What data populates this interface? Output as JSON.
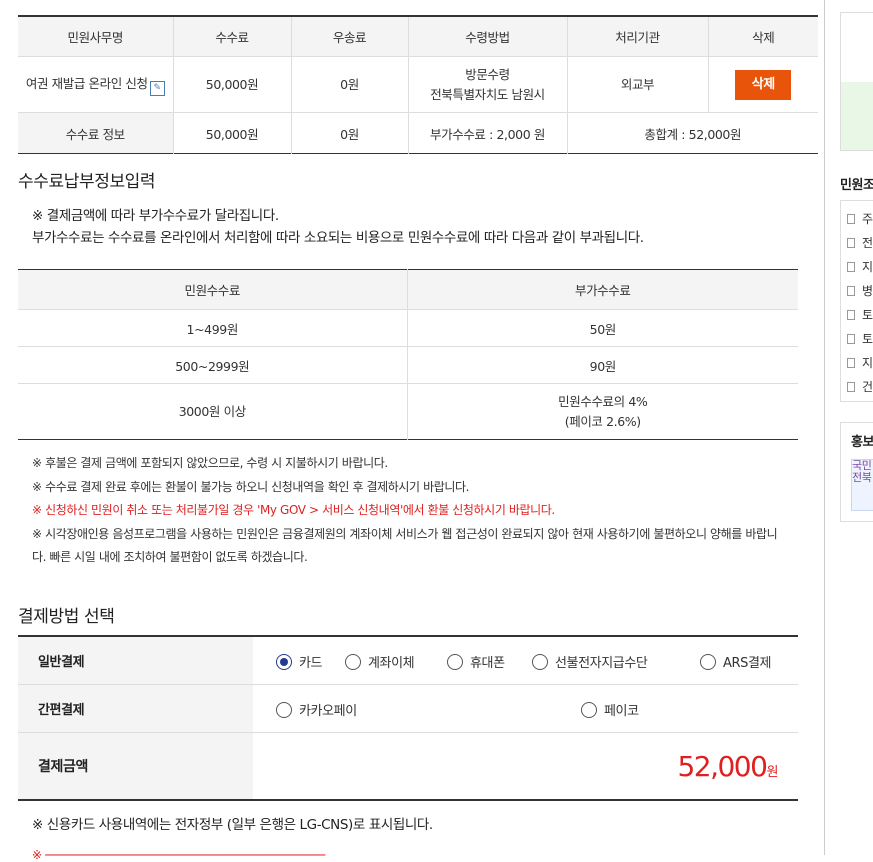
{
  "fee_table": {
    "headers": [
      "민원사무명",
      "수수료",
      "우송료",
      "수령방법",
      "처리기관",
      "삭제"
    ],
    "row": {
      "name": "여권 재발급 온라인 신청",
      "fee": "50,000원",
      "postage": "0원",
      "receipt_line1": "방문수령",
      "receipt_line2": "전북특별자치도 남원시",
      "agency": "외교부",
      "delete_label": "삭제"
    },
    "summary": {
      "label": "수수료 정보",
      "fee": "50,000원",
      "postage": "0원",
      "surcharge": "부가수수료 : 2,000 원",
      "total": "총합계 : 52,000원"
    }
  },
  "section_payment_info": {
    "title": "수수료납부정보입력",
    "notice_line1": "※ 결제금액에 따라 부가수수료가 달라집니다.",
    "notice_line2": "부가수수료는 수수료를 온라인에서 처리함에 따라 소요되는 비용으로 민원수수료에 따라 다음과 같이 부과됩니다."
  },
  "surcharge_table": {
    "headers": [
      "민원수수료",
      "부가수수료"
    ],
    "rows": [
      {
        "range": "1~499원",
        "charge": "50원"
      },
      {
        "range": "500~2999원",
        "charge": "90원"
      },
      {
        "range": "3000원 이상",
        "charge": "민원수수료의 4%",
        "charge2": "(페이코 2.6%)"
      }
    ]
  },
  "notes": [
    "※ 후불은 결제 금액에 포함되지 않았으므로, 수령 시 지불하시기 바랍니다.",
    "※ 수수료 결제 완료 후에는 환불이 불가능 하오니 신청내역을 확인 후 결제하시기 바랍니다.",
    "※ 신청하신 민원이 취소 또는 처리불가일 경우 'My GOV > 서비스 신청내역'에서 환불 신청하시기 바랍니다.",
    "※ 시각장애인용 음성프로그램을 사용하는 민원인은 금융결제원의 계좌이체 서비스가 웹 접근성이 완료되지 않아 현재 사용하기에 불편하오니 양해를 바랍니",
    "다. 빠른 시일 내에 조치하여 불편함이 없도록 하겠습니다."
  ],
  "payment": {
    "title": "결제방법 선택",
    "general_label": "일반결제",
    "general_options": [
      "카드",
      "계좌이체",
      "휴대폰",
      "선불전자지급수단",
      "ARS결제"
    ],
    "selected": "카드",
    "simple_label": "간편결제",
    "simple_options": [
      "카카오페이",
      "페이코"
    ],
    "amount_label": "결제금액",
    "amount_value": "52,000",
    "amount_unit": "원",
    "card_notice": "※ 신용카드 사용내역에는 전자정부 (일부 은행은 LG-CNS)로 표시됩니다."
  },
  "sidebar": {
    "section_title": "민원조",
    "items": [
      "주",
      "전",
      "지",
      "병",
      "토",
      "토",
      "지",
      "건"
    ],
    "promo_title": "홍보",
    "promo_text": "국민 전북"
  },
  "colors": {
    "delete_button": "#e8540a",
    "amount": "#e02020",
    "radio_selected": "#233a8e"
  }
}
